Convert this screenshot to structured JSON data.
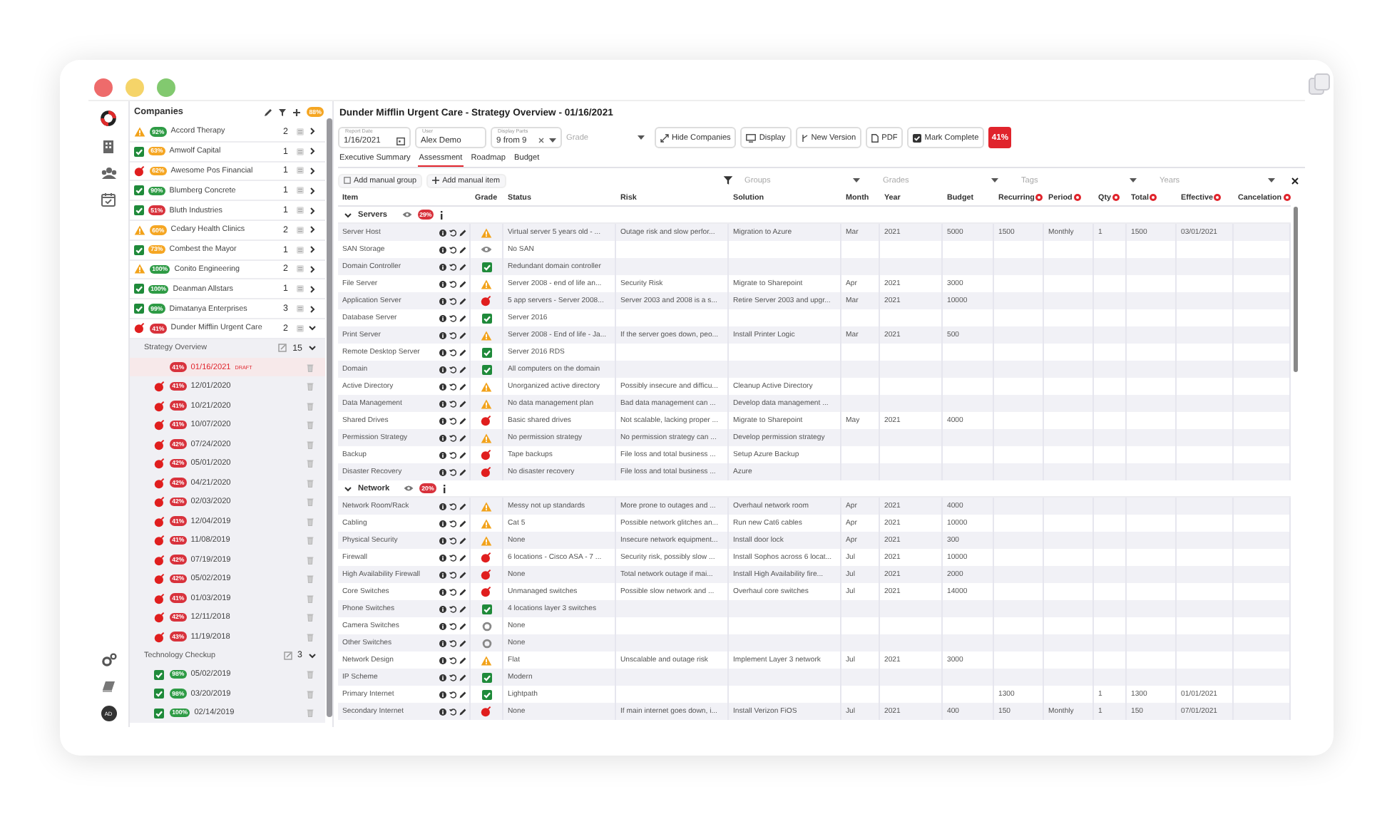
{
  "rail": {
    "avatar": "AD"
  },
  "companies": {
    "title": "Companies",
    "score": "88%",
    "items": [
      {
        "name": "Accord Therapy",
        "kind": "warning",
        "score": "92%",
        "color": "#2e9b45",
        "count": "2",
        "expanded": false
      },
      {
        "name": "Amwolf Capital",
        "kind": "ok",
        "score": "63%",
        "color": "#f5a623",
        "count": "1",
        "expanded": false
      },
      {
        "name": "Awesome Pos Financial",
        "kind": "critical",
        "score": "62%",
        "color": "#f5a623",
        "count": "1",
        "expanded": false
      },
      {
        "name": "Blumberg Concrete",
        "kind": "ok",
        "score": "90%",
        "color": "#2e9b45",
        "count": "1",
        "expanded": false
      },
      {
        "name": "Bluth Industries",
        "kind": "ok",
        "score": "51%",
        "color": "#d8323c",
        "count": "1",
        "expanded": false
      },
      {
        "name": "Cedary Health Clinics",
        "kind": "warning",
        "score": "60%",
        "color": "#f5a623",
        "count": "2",
        "expanded": false
      },
      {
        "name": "Combest the Mayor",
        "kind": "ok",
        "score": "73%",
        "color": "#f5a623",
        "count": "1",
        "expanded": false
      },
      {
        "name": "Conito Engineering",
        "kind": "warning",
        "score": "100%",
        "color": "#2e9b45",
        "count": "2",
        "expanded": false
      },
      {
        "name": "Deanman Allstars",
        "kind": "ok",
        "score": "100%",
        "color": "#2e9b45",
        "count": "1",
        "expanded": false
      },
      {
        "name": "Dimatanya Enterprises",
        "kind": "ok",
        "score": "99%",
        "color": "#2e9b45",
        "count": "3",
        "expanded": false
      },
      {
        "name": "Dunder Mifflin Urgent Care",
        "kind": "critical",
        "score": "41%",
        "color": "#d8323c",
        "count": "2",
        "expanded": true,
        "children": [
          {
            "name": "Strategy Overview",
            "count": "15",
            "expanded": true,
            "versions": [
              {
                "date": "01/16/2021",
                "tag": "DRAFT",
                "score": "41%",
                "color": "#d8323c",
                "selected": true
              },
              {
                "date": "12/01/2020",
                "kind": "critical",
                "score": "41%",
                "color": "#d8323c",
                "selected": false
              },
              {
                "date": "10/21/2020",
                "kind": "critical",
                "score": "41%",
                "color": "#d8323c",
                "selected": false
              },
              {
                "date": "10/07/2020",
                "kind": "critical",
                "score": "41%",
                "color": "#d8323c",
                "selected": false
              },
              {
                "date": "07/24/2020",
                "kind": "critical",
                "score": "42%",
                "color": "#d8323c",
                "selected": false
              },
              {
                "date": "05/01/2020",
                "kind": "critical",
                "score": "42%",
                "color": "#d8323c",
                "selected": false
              },
              {
                "date": "04/21/2020",
                "kind": "critical",
                "score": "42%",
                "color": "#d8323c",
                "selected": false
              },
              {
                "date": "02/03/2020",
                "kind": "critical",
                "score": "42%",
                "color": "#d8323c",
                "selected": false
              },
              {
                "date": "12/04/2019",
                "kind": "critical",
                "score": "41%",
                "color": "#d8323c",
                "selected": false
              },
              {
                "date": "11/08/2019",
                "kind": "critical",
                "score": "41%",
                "color": "#d8323c",
                "selected": false
              },
              {
                "date": "07/19/2019",
                "kind": "critical",
                "score": "42%",
                "color": "#d8323c",
                "selected": false
              },
              {
                "date": "05/02/2019",
                "kind": "critical",
                "score": "42%",
                "color": "#d8323c",
                "selected": false
              },
              {
                "date": "01/03/2019",
                "kind": "critical",
                "score": "41%",
                "color": "#d8323c",
                "selected": false
              },
              {
                "date": "12/11/2018",
                "kind": "critical",
                "score": "42%",
                "color": "#d8323c",
                "selected": false
              },
              {
                "date": "11/19/2018",
                "kind": "critical",
                "score": "43%",
                "color": "#d8323c",
                "selected": false
              }
            ]
          },
          {
            "name": "Technology Checkup",
            "count": "3",
            "expanded": true,
            "versions": [
              {
                "date": "05/02/2019",
                "kind": "ok",
                "score": "98%",
                "color": "#2e9b45",
                "selected": false
              },
              {
                "date": "03/20/2019",
                "kind": "ok",
                "score": "98%",
                "color": "#2e9b45",
                "selected": false
              },
              {
                "date": "02/14/2019",
                "kind": "ok",
                "score": "100%",
                "color": "#2e9b45",
                "selected": false
              }
            ]
          }
        ]
      }
    ]
  },
  "title": "Dunder Mifflin Urgent Care - Strategy Overview - 01/16/2021",
  "fields": [
    {
      "kind": "date",
      "label": "Report Date",
      "value": "1/16/2021"
    },
    {
      "kind": "text",
      "label": "User",
      "value": "Alex Demo"
    },
    {
      "kind": "multi",
      "label": "Display Parts",
      "value": "9 from 9"
    },
    {
      "kind": "select",
      "placeholder": "Grade"
    }
  ],
  "buttons": [
    {
      "kind": "expand",
      "label": "Hide Companies"
    },
    {
      "kind": "monitor",
      "label": "Display"
    },
    {
      "kind": "version",
      "label": "New Version"
    },
    {
      "kind": "file",
      "label": "PDF"
    },
    {
      "kind": "check",
      "label": "Mark Complete"
    }
  ],
  "score": "41%",
  "tabs": [
    {
      "label": "Executive Summary",
      "selected": false
    },
    {
      "label": "Assessment",
      "selected": true
    },
    {
      "label": "Roadmap",
      "selected": false
    },
    {
      "label": "Budget",
      "selected": false
    }
  ],
  "toolbar": {
    "buttons": [
      {
        "kind": "square",
        "label": "Add manual group"
      },
      {
        "kind": "plus",
        "label": "Add manual item"
      }
    ],
    "filters": [
      {
        "placeholder": "Groups"
      },
      {
        "placeholder": "Grades"
      },
      {
        "placeholder": "Tags"
      },
      {
        "placeholder": "Years"
      }
    ]
  },
  "table": {
    "columns": [
      {
        "label": "Item",
        "marked": false
      },
      {
        "label": "Grade",
        "marked": false
      },
      {
        "label": "Status",
        "marked": false
      },
      {
        "label": "Risk",
        "marked": false
      },
      {
        "label": "Solution",
        "marked": false
      },
      {
        "label": "Month",
        "marked": false
      },
      {
        "label": "Year",
        "marked": false
      },
      {
        "label": "Budget",
        "marked": false
      },
      {
        "label": "Recurring",
        "marked": true
      },
      {
        "label": "Period",
        "marked": true
      },
      {
        "label": "Qty",
        "marked": true
      },
      {
        "label": "Total",
        "marked": true
      },
      {
        "label": "Effective",
        "marked": true
      },
      {
        "label": "Cancelation",
        "marked": true
      }
    ],
    "groups": [
      {
        "name": "Servers",
        "score": "29%",
        "expanded": true,
        "rows": [
          {
            "item": "Server Host",
            "kind": "warning",
            "status": "Virtual server 5 years old - ...",
            "risk": "Outage risk and slow perfor...",
            "solution": "Migration to Azure",
            "month": "Mar",
            "year": "2021",
            "budget": "5000",
            "recurring": "1500",
            "period": "Monthly",
            "qty": "1",
            "total": "1500",
            "effective": "03/01/2021"
          },
          {
            "item": "SAN Storage",
            "kind": "unknown",
            "status": "No SAN"
          },
          {
            "item": "Domain Controller",
            "kind": "ok",
            "status": "Redundant domain controller"
          },
          {
            "item": "File Server",
            "kind": "warning",
            "status": "Server 2008 - end of life an...",
            "risk": "Security Risk",
            "solution": "Migrate to Sharepoint",
            "month": "Apr",
            "year": "2021",
            "budget": "3000"
          },
          {
            "item": "Application Server",
            "kind": "critical",
            "status": "5 app servers - Server 2008...",
            "risk": "Server 2003 and 2008 is a s...",
            "solution": "Retire Server 2003 and upgr...",
            "month": "Mar",
            "year": "2021",
            "budget": "10000"
          },
          {
            "item": "Database Server",
            "kind": "ok",
            "status": "Server 2016"
          },
          {
            "item": "Print Server",
            "kind": "warning",
            "status": "Server 2008 - End of life - Ja...",
            "risk": "If the server goes down, peo...",
            "solution": "Install Printer Logic",
            "month": "Mar",
            "year": "2021",
            "budget": "500"
          },
          {
            "item": "Remote Desktop Server",
            "kind": "ok",
            "status": "Server 2016 RDS"
          },
          {
            "item": "Domain",
            "kind": "ok",
            "status": "All computers on the domain"
          },
          {
            "item": "Active Directory",
            "kind": "warning",
            "status": "Unorganized active directory",
            "risk": "Possibly insecure and difficu...",
            "solution": "Cleanup Active Directory"
          },
          {
            "item": "Data Management",
            "kind": "warning",
            "status": "No data management plan",
            "risk": "Bad data management can ...",
            "solution": "Develop data management ..."
          },
          {
            "item": "Shared Drives",
            "kind": "critical",
            "status": "Basic shared drives",
            "risk": "Not scalable, lacking proper ...",
            "solution": "Migrate to Sharepoint",
            "month": "May",
            "year": "2021",
            "budget": "4000"
          },
          {
            "item": "Permission Strategy",
            "kind": "warning",
            "status": "No permission strategy",
            "risk": "No permission strategy can ...",
            "solution": "Develop permission strategy"
          },
          {
            "item": "Backup",
            "kind": "critical",
            "status": "Tape backups",
            "risk": "File loss and total business ...",
            "solution": "Setup Azure Backup"
          },
          {
            "item": "Disaster Recovery",
            "kind": "critical",
            "status": "No disaster recovery",
            "risk": "File loss and total business ...",
            "solution": "Azure"
          }
        ]
      },
      {
        "name": "Network",
        "score": "20%",
        "expanded": true,
        "rows": [
          {
            "item": "Network Room/Rack",
            "kind": "warning",
            "status": "Messy not up standards",
            "risk": "More prone to outages and ...",
            "solution": "Overhaul network room",
            "month": "Apr",
            "year": "2021",
            "budget": "4000"
          },
          {
            "item": "Cabling",
            "kind": "warning",
            "status": "Cat 5",
            "risk": "Possible network glitches an...",
            "solution": "Run new Cat6 cables",
            "month": "Apr",
            "year": "2021",
            "budget": "10000"
          },
          {
            "item": "Physical Security",
            "kind": "warning",
            "status": "None",
            "risk": "Insecure network equipment...",
            "solution": "Install door lock",
            "month": "Apr",
            "year": "2021",
            "budget": "300"
          },
          {
            "item": "Firewall",
            "kind": "critical",
            "status": "6 locations - Cisco ASA - 7 ...",
            "risk": "Security risk, possibly slow ...",
            "solution": "Install Sophos across 6 locat...",
            "month": "Jul",
            "year": "2021",
            "budget": "10000"
          },
          {
            "item": "High Availability Firewall",
            "kind": "critical",
            "status": "None",
            "risk": "Total network outage if mai...",
            "solution": "Install High Availability fire...",
            "month": "Jul",
            "year": "2021",
            "budget": "2000"
          },
          {
            "item": "Core Switches",
            "kind": "critical",
            "status": "Unmanaged switches",
            "risk": "Possible slow network and ...",
            "solution": "Overhaul core switches",
            "month": "Jul",
            "year": "2021",
            "budget": "14000"
          },
          {
            "item": "Phone Switches",
            "kind": "ok",
            "status": "4 locations layer 3 switches"
          },
          {
            "item": "Camera Switches",
            "kind": "na",
            "status": "None"
          },
          {
            "item": "Other Switches",
            "kind": "na",
            "status": "None"
          },
          {
            "item": "Network Design",
            "kind": "warning",
            "status": "Flat",
            "risk": "Unscalable and outage risk",
            "solution": "Implement Layer 3 network",
            "month": "Jul",
            "year": "2021",
            "budget": "3000"
          },
          {
            "item": "IP Scheme",
            "kind": "ok",
            "status": "Modern"
          },
          {
            "item": "Primary Internet",
            "kind": "ok",
            "status": "Lightpath",
            "recurring": "1300",
            "qty": "1",
            "total": "1300",
            "effective": "01/01/2021"
          },
          {
            "item": "Secondary Internet",
            "kind": "critical",
            "status": "None",
            "risk": "If main internet goes down, i...",
            "solution": "Install Verizon FiOS",
            "month": "Jul",
            "year": "2021",
            "budget": "400",
            "recurring": "150",
            "period": "Monthly",
            "qty": "1",
            "total": "150",
            "effective": "07/01/2021"
          }
        ]
      }
    ]
  }
}
